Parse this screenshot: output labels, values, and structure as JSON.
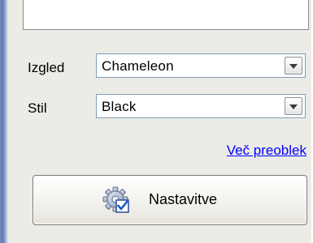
{
  "appearance": {
    "label": "Izgled",
    "value": "Chameleon"
  },
  "style": {
    "label": "Stil",
    "value": "Black"
  },
  "more_skins_link": "Več preoblek",
  "settings_button": {
    "label": "Nastavitve",
    "icon": "gear-check-icon"
  },
  "colors": {
    "link": "#0000ff",
    "frame_accent": "#5d75b3"
  }
}
